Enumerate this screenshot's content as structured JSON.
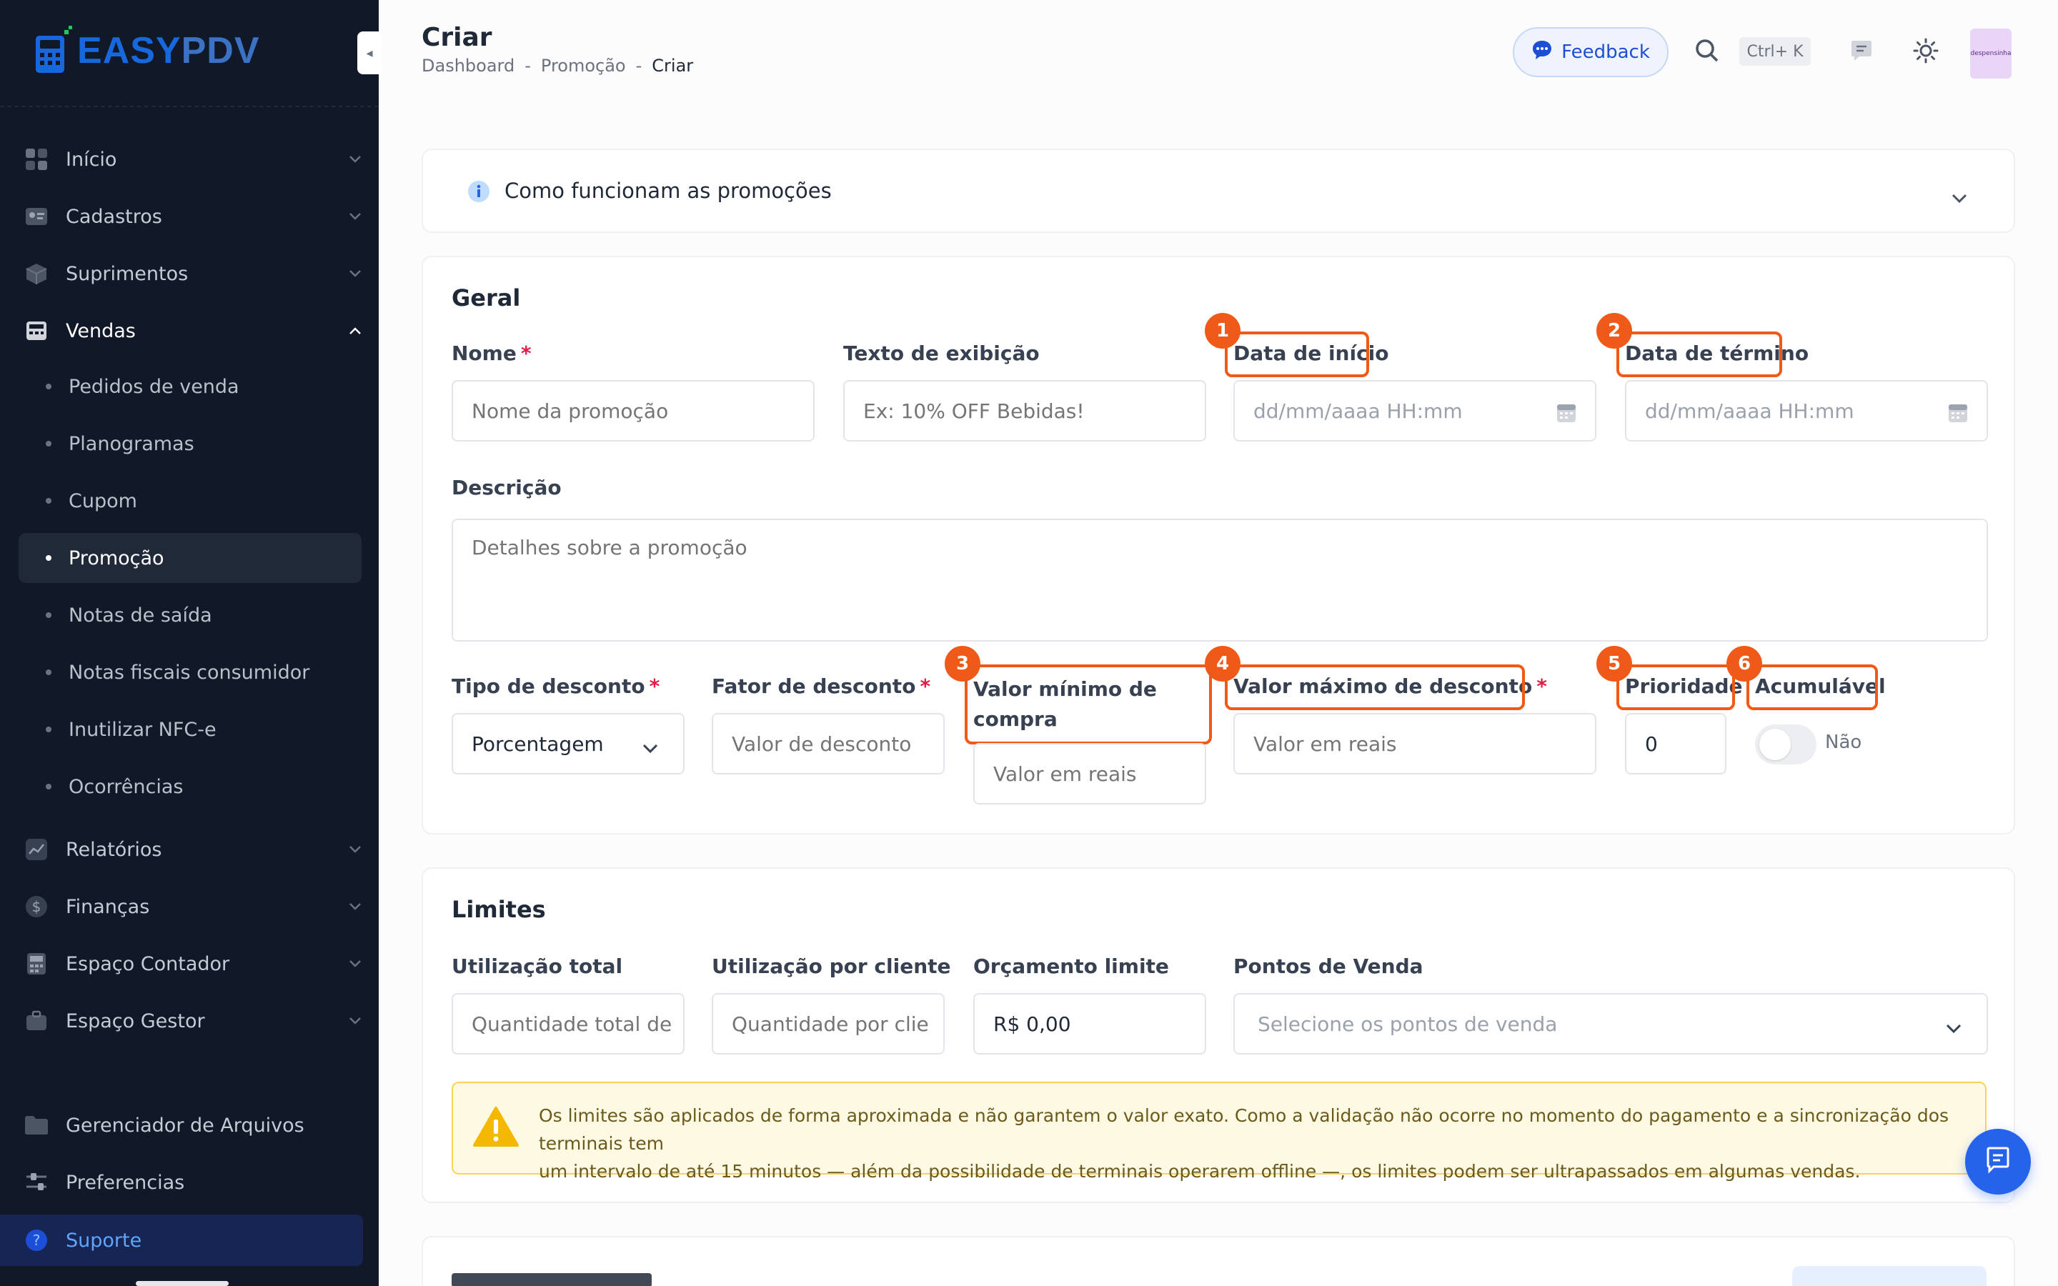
{
  "brand": {
    "easy": "EASY",
    "pdv": "PDV"
  },
  "colors": {
    "sidebar_bg": "#111827",
    "accent": "#1668dc",
    "highlight": "#f05a18",
    "required": "#e11d48",
    "warning_bg": "#fef9e3"
  },
  "sidebar": {
    "items": [
      {
        "label": "Início",
        "icon": "home-grid-icon"
      },
      {
        "label": "Cadastros",
        "icon": "id-card-icon"
      },
      {
        "label": "Suprimentos",
        "icon": "box-icon"
      },
      {
        "label": "Vendas",
        "icon": "register-icon"
      }
    ],
    "vendas_sub": [
      {
        "label": "Pedidos de venda"
      },
      {
        "label": "Planogramas"
      },
      {
        "label": "Cupom"
      },
      {
        "label": "Promoção"
      },
      {
        "label": "Notas de saída"
      },
      {
        "label": "Notas fiscais consumidor"
      },
      {
        "label": "Inutilizar NFC-e"
      },
      {
        "label": "Ocorrências"
      }
    ],
    "items2": [
      {
        "label": "Relatórios",
        "icon": "chart-icon"
      },
      {
        "label": "Finanças",
        "icon": "dollar-icon"
      },
      {
        "label": "Espaço Contador",
        "icon": "calculator-icon"
      },
      {
        "label": "Espaço Gestor",
        "icon": "briefcase-icon"
      }
    ],
    "bottom": [
      {
        "label": "Gerenciador de Arquivos",
        "icon": "folder-icon"
      },
      {
        "label": "Preferencias",
        "icon": "sliders-icon"
      }
    ],
    "support": "Suporte"
  },
  "header": {
    "title": "Criar",
    "breadcrumb": [
      "Dashboard",
      "-",
      "Promoção",
      "-",
      "Criar"
    ],
    "feedback": "Feedback",
    "shortcut": "Ctrl+ K",
    "avatar_text": "despensinha"
  },
  "info": {
    "title": "Como funcionam as promoções"
  },
  "geral": {
    "title": "Geral",
    "nome": {
      "label": "Nome",
      "placeholder": "Nome da promoção"
    },
    "texto": {
      "label": "Texto de exibição",
      "placeholder": "Ex: 10% OFF Bebidas!"
    },
    "inicio": {
      "label": "Data de início",
      "placeholder": "dd/mm/aaaa HH:mm"
    },
    "termino": {
      "label": "Data de término",
      "placeholder": "dd/mm/aaaa HH:mm"
    },
    "descricao": {
      "label": "Descrição",
      "placeholder": "Detalhes sobre a promoção"
    },
    "tipo": {
      "label": "Tipo de desconto",
      "value": "Porcentagem"
    },
    "fator": {
      "label": "Fator de desconto",
      "placeholder": "Valor de desconto"
    },
    "minimo": {
      "label_1": "Valor mínimo de",
      "label_2": "compra",
      "placeholder": "Valor em reais"
    },
    "maximo": {
      "label": "Valor máximo de desconto",
      "placeholder": "Valor em reais"
    },
    "prioridade": {
      "label": "Prioridade",
      "value": "0"
    },
    "acumulavel": {
      "label": "Acumulável",
      "value": "Não"
    },
    "required_mark": "*",
    "badges": [
      "1",
      "2",
      "3",
      "4",
      "5",
      "6"
    ]
  },
  "limites": {
    "title": "Limites",
    "total": {
      "label": "Utilização total",
      "placeholder": "Quantidade total de"
    },
    "cliente": {
      "label": "Utilização por cliente",
      "placeholder": "Quantidade por clie"
    },
    "orcamento": {
      "label": "Orçamento limite",
      "value": "R$ 0,00"
    },
    "pontos": {
      "label": "Pontos de Venda",
      "placeholder": "Selecione os pontos de venda"
    },
    "warning_1": "Os limites são aplicados de forma aproximada e não garantem o valor exato. Como a validação não ocorre no momento do pagamento e a sincronização dos terminais tem",
    "warning_2": "um intervalo de até 15 minutos — além da possibilidade de terminais operarem offline —, os limites podem ser ultrapassados em algumas vendas."
  }
}
